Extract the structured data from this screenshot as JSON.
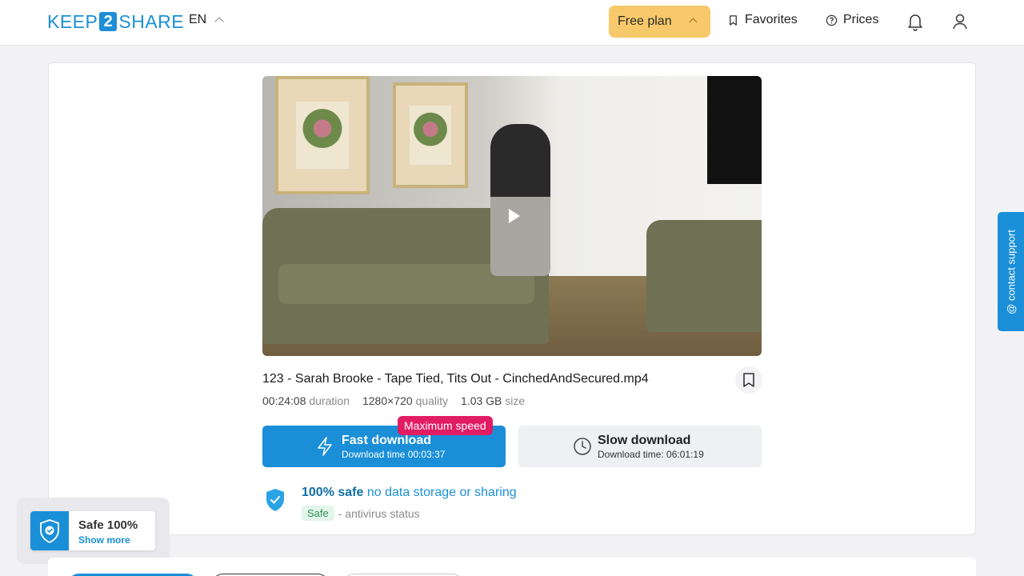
{
  "header": {
    "logo": {
      "left": "KEEP",
      "mid": "2",
      "right": "SHARE"
    },
    "language": "EN",
    "plan_label": "Free plan",
    "favorites_label": "Favorites",
    "prices_label": "Prices"
  },
  "file": {
    "title": "123 - Sarah Brooke - Tape Tied, Tits Out - CinchedAndSecured.mp4",
    "duration_value": "00:24:08",
    "duration_label": "duration",
    "quality_value": "1280×720",
    "quality_label": "quality",
    "size_value": "1.03 GB",
    "size_label": "size"
  },
  "download": {
    "badge": "Maximum speed",
    "fast_label": "Fast download",
    "fast_time": "Download time 00:03:37",
    "slow_label": "Slow download",
    "slow_time": "Download time: 06:01:19"
  },
  "safety": {
    "strong": "100% safe",
    "light": "no data storage or sharing",
    "tag": "Safe",
    "status_text": "- antivirus status"
  },
  "support_label": "@ contact support",
  "safe_widget": {
    "title": "Safe 100%",
    "link": "Show more"
  },
  "colors": {
    "accent": "#1a8fd8",
    "plan_button": "#f7c96a",
    "badge": "#e21c63",
    "safe_tag_bg": "#e2f6ea"
  }
}
